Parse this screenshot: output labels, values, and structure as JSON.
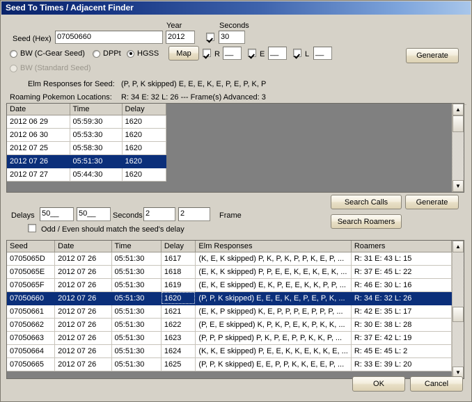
{
  "window": {
    "title": "Seed To Times / Adjacent Finder"
  },
  "form": {
    "seed_label": "Seed (Hex)",
    "seed_value": "07050660",
    "year_label": "Year",
    "year_value": "2012",
    "seconds_label": "Seconds",
    "seconds_value": "30",
    "seconds_checked": true,
    "radio_bw_cgear": "BW (C-Gear Seed)",
    "radio_dppt": "DPPt",
    "radio_hgss": "HGSS",
    "radio_bw_standard": "BW (Standard Seed)",
    "selected_game": "HGSS",
    "map_button": "Map",
    "generate_button_top": "Generate",
    "r_label": "R",
    "r_value": "__",
    "r_checked": true,
    "e_label": "E",
    "e_value": "__",
    "e_checked": true,
    "l_label": "L",
    "l_value": "__",
    "l_checked": true
  },
  "info": {
    "elm_label": "Elm Responses for Seed:",
    "elm_value": "(P, P, K skipped)   E, E, E, K, E, P, E, P, K, P",
    "roaming_label": "Roaming Pokemon Locations:",
    "roaming_value": "R: 34  E: 32  L: 26  ---  Frame(s) Advanced: 3"
  },
  "times_grid": {
    "columns": [
      "Date",
      "Time",
      "Delay"
    ],
    "rows": [
      {
        "date": "2012 06 29",
        "time": "05:59:30",
        "delay": "1620",
        "selected": false
      },
      {
        "date": "2012 06 30",
        "time": "05:53:30",
        "delay": "1620",
        "selected": false
      },
      {
        "date": "2012 07 25",
        "time": "05:58:30",
        "delay": "1620",
        "selected": false
      },
      {
        "date": "2012 07 26",
        "time": "05:51:30",
        "delay": "1620",
        "selected": true
      },
      {
        "date": "2012 07 27",
        "time": "05:44:30",
        "delay": "1620",
        "selected": false
      }
    ]
  },
  "search_controls": {
    "delays_label": "Delays",
    "delays_minus_sign": "-",
    "delays_plus_sign": "+",
    "delays_minus_value": "50__",
    "delays_plus_value": "50__",
    "seconds_label": "Seconds",
    "seconds_minus_sign": "-",
    "seconds_plus_sign": "+",
    "seconds_minus_value": "2",
    "seconds_plus_value": "2",
    "frame_label": "Frame",
    "odd_even_label": "Odd / Even should match the seed's delay",
    "odd_even_checked": false,
    "search_calls_button": "Search Calls",
    "generate_button": "Generate",
    "search_roamers_button": "Search Roamers"
  },
  "results_grid": {
    "columns": [
      "Seed",
      "Date",
      "Time",
      "Delay",
      "Elm Responses",
      "Roamers"
    ],
    "rows": [
      {
        "seed": "0705065D",
        "date": "2012 07 26",
        "time": "05:51:30",
        "delay": "1617",
        "elm": "(K, E, K skipped)   P, K, P, K, P, P, K, E, P, ...",
        "roamers": "R: 31  E: 43  L: 15",
        "selected": false
      },
      {
        "seed": "0705065E",
        "date": "2012 07 26",
        "time": "05:51:30",
        "delay": "1618",
        "elm": "(E, K, K skipped)   P, P, E, E, K, E, K, E, K, ...",
        "roamers": "R: 37  E: 45  L: 22",
        "selected": false
      },
      {
        "seed": "0705065F",
        "date": "2012 07 26",
        "time": "05:51:30",
        "delay": "1619",
        "elm": "(E, K, E skipped)   E, K, P, E, E, K, K, P, P, ...",
        "roamers": "R: 46  E: 30  L: 16",
        "selected": false
      },
      {
        "seed": "07050660",
        "date": "2012 07 26",
        "time": "05:51:30",
        "delay": "1620",
        "elm": "(P, P, K skipped)   E, E, E, K, E, P, E, P, K, ...",
        "roamers": "R: 34  E: 32  L: 26",
        "selected": true
      },
      {
        "seed": "07050661",
        "date": "2012 07 26",
        "time": "05:51:30",
        "delay": "1621",
        "elm": "(E, K, P skipped)   K, E, P, P, P, E, P, P, P, ...",
        "roamers": "R: 42  E: 35  L: 17",
        "selected": false
      },
      {
        "seed": "07050662",
        "date": "2012 07 26",
        "time": "05:51:30",
        "delay": "1622",
        "elm": "(P, E, E skipped)   K, P, K, P, E, K, P, K, K, ...",
        "roamers": "R: 30  E: 38  L: 28",
        "selected": false
      },
      {
        "seed": "07050663",
        "date": "2012 07 26",
        "time": "05:51:30",
        "delay": "1623",
        "elm": "(P, P, P skipped)   P, K, P, E, P, P, K, K, P, ...",
        "roamers": "R: 37  E: 42  L: 19",
        "selected": false
      },
      {
        "seed": "07050664",
        "date": "2012 07 26",
        "time": "05:51:30",
        "delay": "1624",
        "elm": "(K, K, E skipped)   P, E, E, K, K, E, K, K, E, ...",
        "roamers": "R: 45  E: 45  L: 2",
        "selected": false
      },
      {
        "seed": "07050665",
        "date": "2012 07 26",
        "time": "05:51:30",
        "delay": "1625",
        "elm": "(P, P, K skipped)   E, E, P, P, K, K, E, E, P, ...",
        "roamers": "R: 33  E: 39  L: 20",
        "selected": false
      }
    ]
  },
  "footer": {
    "ok_button": "OK",
    "cancel_button": "Cancel"
  },
  "scrollbars": {
    "up_arrow": "▲",
    "down_arrow": "▼"
  },
  "colors": {
    "selection": "#0b2f7a",
    "face": "#d6d2c8",
    "grid_back": "#808080",
    "title_left": "#0a246a",
    "title_right": "#a8c6ea"
  }
}
